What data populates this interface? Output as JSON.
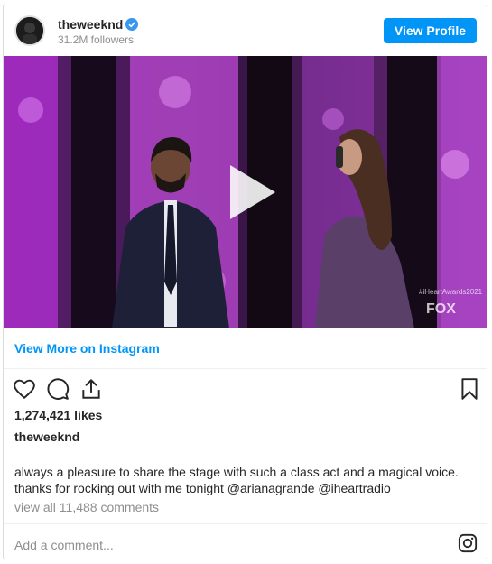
{
  "header": {
    "username": "theweeknd",
    "followers": "31.2M followers",
    "view_profile_label": "View Profile"
  },
  "media": {
    "watermark_tag": "#iHeartAwards2021",
    "network_logo": "FOX"
  },
  "view_more_label": "View More on Instagram",
  "likes": "1,274,421 likes",
  "caption": {
    "author": "theweeknd",
    "text": "always a pleasure to share the stage with such a class act and a magical voice. thanks for rocking out with me tonight",
    "mention_1": "@arianagrande",
    "mention_2": "@iheartradio"
  },
  "comments_link": "view all 11,488 comments",
  "add_comment_placeholder": "Add a comment...",
  "colors": {
    "accent": "#0095f6",
    "text": "#262626",
    "muted": "#8e8e8e"
  },
  "icons": [
    "verified-badge-icon",
    "heart-icon",
    "comment-icon",
    "share-icon",
    "bookmark-icon",
    "instagram-icon",
    "play-icon"
  ]
}
